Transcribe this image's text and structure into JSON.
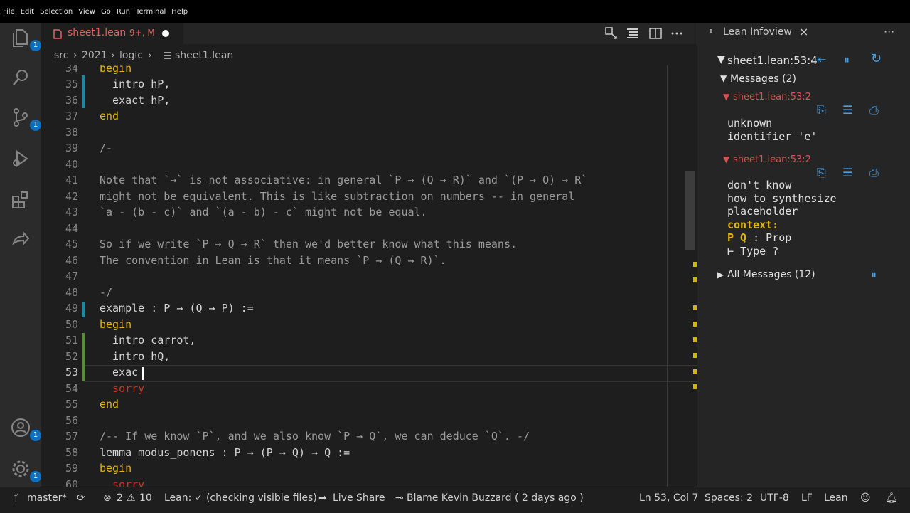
{
  "menu": [
    "File",
    "Edit",
    "Selection",
    "View",
    "Go",
    "Run",
    "Terminal",
    "Help"
  ],
  "activity_badges": {
    "explorer": "1",
    "scm": "1",
    "accounts": "1",
    "settings": "1"
  },
  "tab": {
    "filename": "sheet1.lean",
    "status": "9+, M"
  },
  "breadcrumb": [
    "src",
    "2021",
    "logic",
    "sheet1.lean"
  ],
  "code_lines": [
    {
      "n": "34",
      "text": "begin"
    },
    {
      "n": "35",
      "text": "  intro hP,"
    },
    {
      "n": "36",
      "text": "  exact hP,"
    },
    {
      "n": "37",
      "text": "end"
    },
    {
      "n": "38",
      "text": ""
    },
    {
      "n": "39",
      "text": "/-"
    },
    {
      "n": "40",
      "text": ""
    },
    {
      "n": "41",
      "text": "Note that `→` is not associative: in general `P → (Q → R)` and `(P → Q) → R`"
    },
    {
      "n": "42",
      "text": "might not be equivalent. This is like subtraction on numbers -- in general"
    },
    {
      "n": "43",
      "text": "`a - (b - c)` and `(a - b) - c` might not be equal."
    },
    {
      "n": "44",
      "text": ""
    },
    {
      "n": "45",
      "text": "So if we write `P → Q → R` then we'd better know what this means."
    },
    {
      "n": "46",
      "text": "The convention in Lean is that it means `P → (Q → R)`."
    },
    {
      "n": "47",
      "text": ""
    },
    {
      "n": "48",
      "text": "-/"
    },
    {
      "n": "49",
      "text": "example : P → (Q → P) :="
    },
    {
      "n": "50",
      "text": "begin"
    },
    {
      "n": "51",
      "text": "  intro carrot,"
    },
    {
      "n": "52",
      "text": "  intro hQ,"
    },
    {
      "n": "53",
      "text": "  exac"
    },
    {
      "n": "54",
      "text": "  sorry"
    },
    {
      "n": "55",
      "text": "end"
    },
    {
      "n": "56",
      "text": ""
    },
    {
      "n": "57",
      "text": "/-- If we know `P`, and we also know `P → Q`, we can deduce `Q`. -/"
    },
    {
      "n": "58",
      "text": "lemma modus_ponens : P → (P → Q) → Q :="
    },
    {
      "n": "59",
      "text": "begin"
    },
    {
      "n": "60",
      "text": "  sorry"
    }
  ],
  "infoview": {
    "title": "Lean Infoview",
    "location": "sheet1.lean:53:4",
    "messages_header": "Messages (2)",
    "messages": [
      {
        "loc": "sheet1.lean:53:2",
        "body": [
          "unknown",
          "identifier 'e'"
        ]
      },
      {
        "loc": "sheet1.lean:53:2",
        "body": [
          "don't know",
          "how to synthesize",
          "placeholder"
        ],
        "context_label": "context:",
        "hyp_vars": "P Q",
        "hyp_type": " : Prop",
        "goal": "⊢ Type ?"
      }
    ],
    "all_messages": "All Messages (12)"
  },
  "status": {
    "branch": "master*",
    "errors": "2",
    "warnings": "10",
    "lean_status": "Lean: ✓ (checking visible files)",
    "live_share": "Live Share",
    "blame": "Blame Kevin Buzzard ( 2 days ago )",
    "position": "Ln 53, Col 7",
    "spaces": "Spaces: 2",
    "encoding": "UTF-8",
    "eol": "LF",
    "language": "Lean"
  },
  "colors": {
    "accent": "#0e70c0",
    "error": "#e05050",
    "keyword": "#e5b800",
    "backtick": "#c03a6a"
  }
}
